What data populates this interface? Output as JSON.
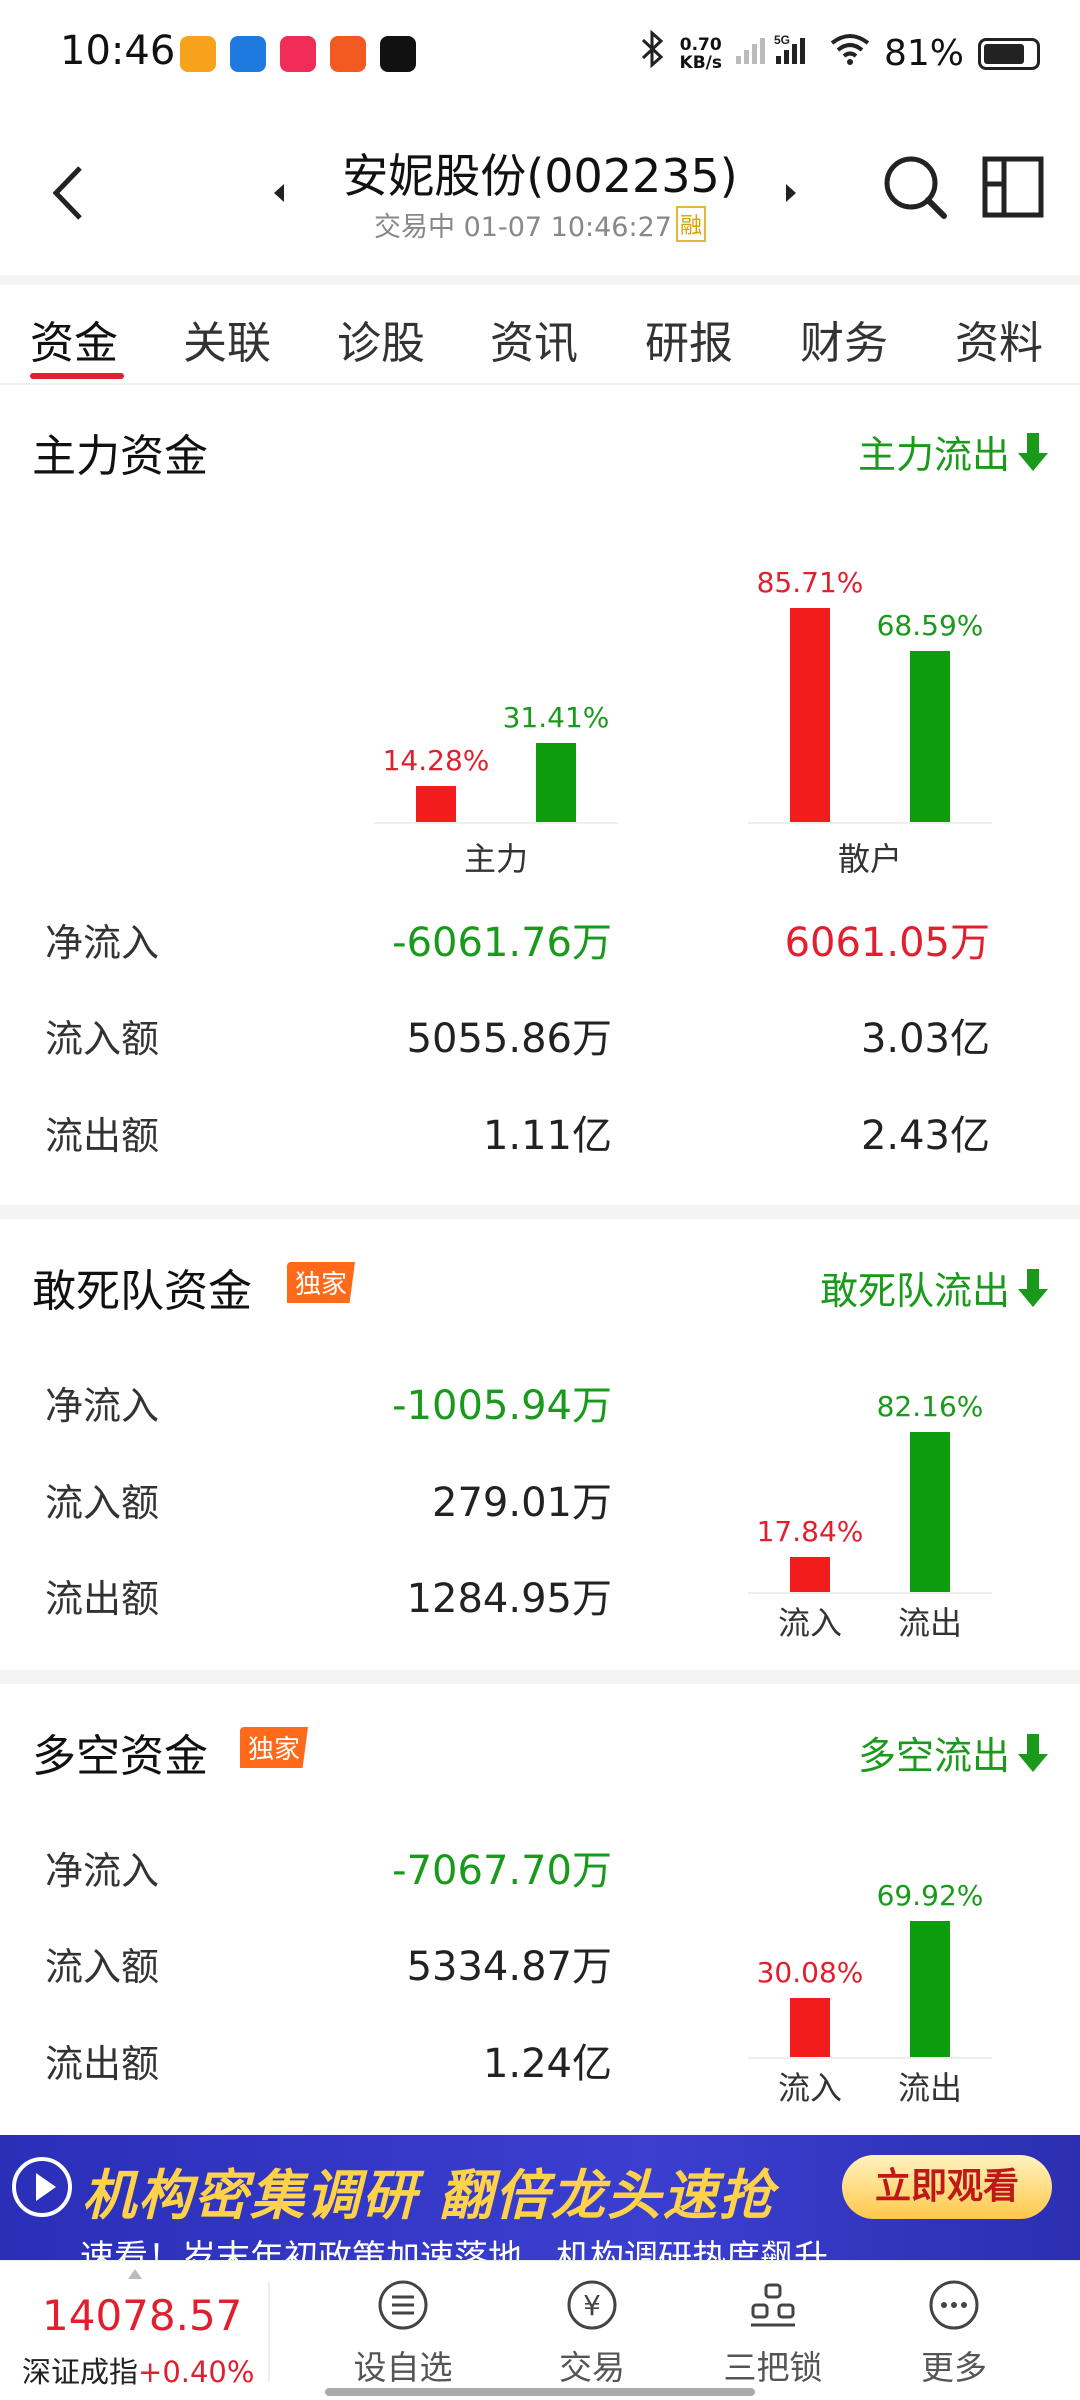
{
  "status_bar": {
    "time": "10:46",
    "speed_top": "0.70",
    "speed_unit": "KB/s",
    "battery": "81%"
  },
  "header": {
    "title": "安妮股份(002235)",
    "subtitle": "交易中 01-07 10:46:27",
    "margin_badge": "融"
  },
  "tabs": [
    "资金",
    "关联",
    "诊股",
    "资讯",
    "研报",
    "财务",
    "资料"
  ],
  "main_funds": {
    "title": "主力资金",
    "flow_label": "主力流出",
    "rows": [
      {
        "label": "净流入",
        "main": "-6061.76万",
        "retail": "6061.05万"
      },
      {
        "label": "流入额",
        "main": "5055.86万",
        "retail": "3.03亿"
      },
      {
        "label": "流出额",
        "main": "1.11亿",
        "retail": "2.43亿"
      }
    ],
    "groups": [
      "主力",
      "散户"
    ]
  },
  "dare_funds": {
    "title": "敢死队资金",
    "badge": "独家",
    "flow_label": "敢死队流出",
    "rows": [
      {
        "label": "净流入",
        "value": "-1005.94万"
      },
      {
        "label": "流入额",
        "value": "279.01万"
      },
      {
        "label": "流出额",
        "value": "1284.95万"
      }
    ],
    "bar_labels": [
      "流入",
      "流出"
    ]
  },
  "longshort_funds": {
    "title": "多空资金",
    "badge": "独家",
    "flow_label": "多空流出",
    "rows": [
      {
        "label": "净流入",
        "value": "-7067.70万"
      },
      {
        "label": "流入额",
        "value": "5334.87万"
      },
      {
        "label": "流出额",
        "value": "1.24亿"
      }
    ],
    "bar_labels": [
      "流入",
      "流出"
    ]
  },
  "banner": {
    "headline": "机构密集调研 翻倍龙头速抢",
    "button": "立即观看",
    "subtext": "速看！岁末年初政策加速落地，机构调研热度飙升"
  },
  "bottom_bar": {
    "index_value": "14078.57",
    "index_name": "深证成指",
    "index_change": "+0.40%",
    "nav": [
      "设自选",
      "交易",
      "三把锁",
      "更多"
    ]
  },
  "chart_data": [
    {
      "type": "bar",
      "categories": [
        "主力",
        "散户"
      ],
      "series": [
        {
          "name": "流入",
          "values": [
            14.28,
            85.71
          ]
        },
        {
          "name": "流出",
          "values": [
            31.41,
            68.59
          ]
        }
      ],
      "labels": [
        [
          "14.28%",
          "31.41%"
        ],
        [
          "85.71%",
          "68.59%"
        ]
      ],
      "colors": {
        "inflow": "#f21c1c",
        "outflow": "#0d9c0d"
      }
    },
    {
      "type": "bar",
      "categories": [
        "流入",
        "流出"
      ],
      "values": [
        17.84,
        82.16
      ],
      "labels": [
        "17.84%",
        "82.16%"
      ]
    },
    {
      "type": "bar",
      "categories": [
        "流入",
        "流出"
      ],
      "values": [
        30.08,
        69.92
      ],
      "labels": [
        "30.08%",
        "69.92%"
      ]
    }
  ]
}
